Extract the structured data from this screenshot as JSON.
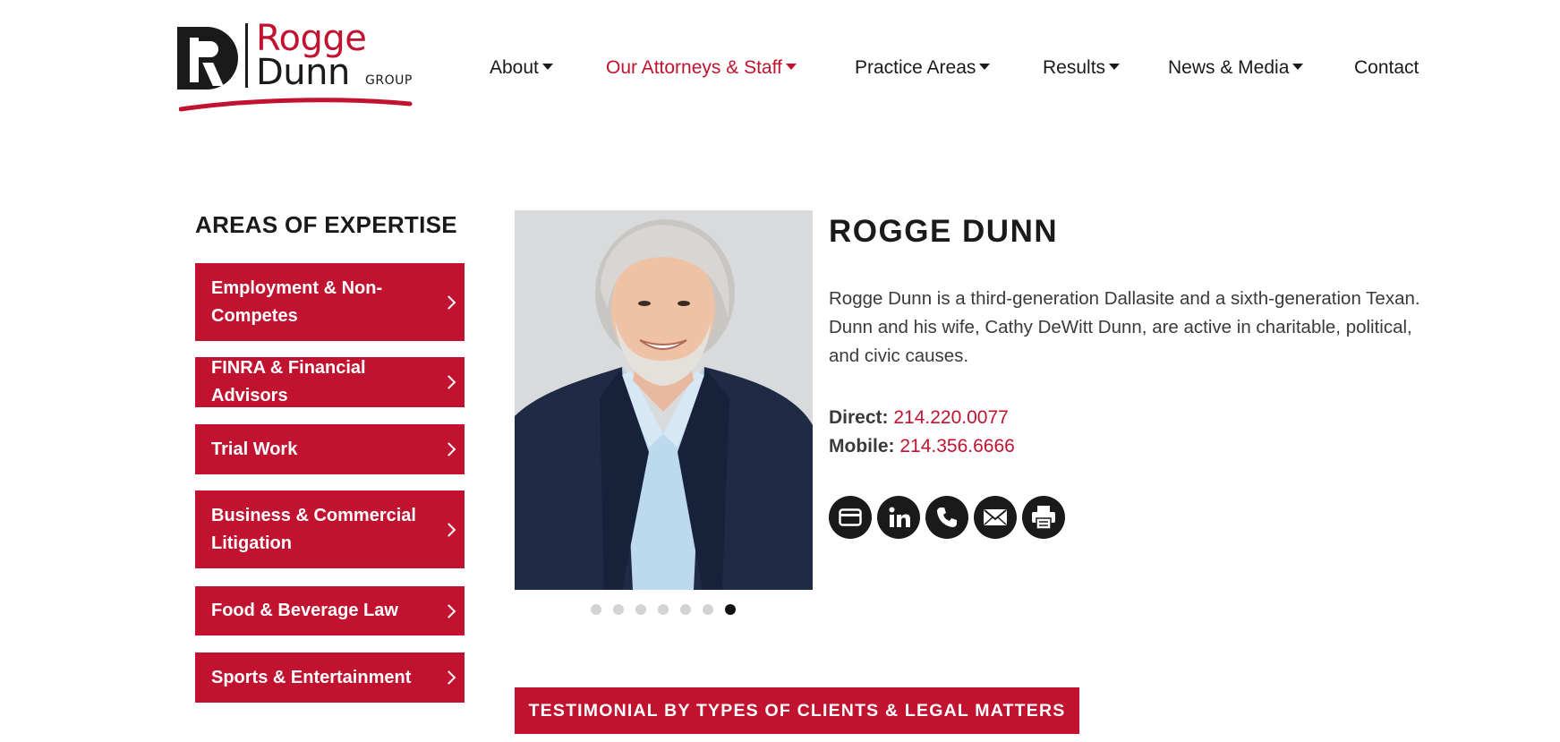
{
  "logo": {
    "line1": "Rogge",
    "line2": "Dunn",
    "suffix": "GROUP"
  },
  "nav": [
    {
      "label": "About",
      "dropdown": true
    },
    {
      "label": "Our Attorneys & Staff",
      "dropdown": true,
      "active": true
    },
    {
      "label": "Practice Areas",
      "dropdown": true
    },
    {
      "label": "Results",
      "dropdown": true
    },
    {
      "label": "News & Media",
      "dropdown": true
    },
    {
      "label": "Contact",
      "dropdown": false
    }
  ],
  "sidebar": {
    "title": "AREAS OF EXPERTISE",
    "items": [
      {
        "label": "Employment & Non-Competes"
      },
      {
        "label": "FINRA & Financial Advisors"
      },
      {
        "label": "Trial Work"
      },
      {
        "label": "Business & Commercial Litigation"
      },
      {
        "label": "Food & Beverage Law"
      },
      {
        "label": "Sports & Entertainment"
      }
    ]
  },
  "profile": {
    "name": "ROGGE DUNN",
    "bio": "Rogge Dunn is a third-generation Dallasite and a sixth-generation Texan. Dunn and his wife, Cathy DeWitt Dunn, are active in charitable, political, and civic causes.",
    "direct_label": "Direct:",
    "direct_phone": "214.220.0077",
    "mobile_label": "Mobile:",
    "mobile_phone": "214.356.6666",
    "icons": [
      "vcard-icon",
      "linkedin-icon",
      "phone-icon",
      "email-icon",
      "print-icon"
    ],
    "slides_total": 7,
    "slide_active": 7
  },
  "testimonial_button": "TESTIMONIAL BY TYPES OF CLIENTS & LEGAL MATTERS",
  "colors": {
    "brand_red": "#c1122f",
    "dark": "#1a1a1a",
    "text": "#3a3a3a"
  }
}
